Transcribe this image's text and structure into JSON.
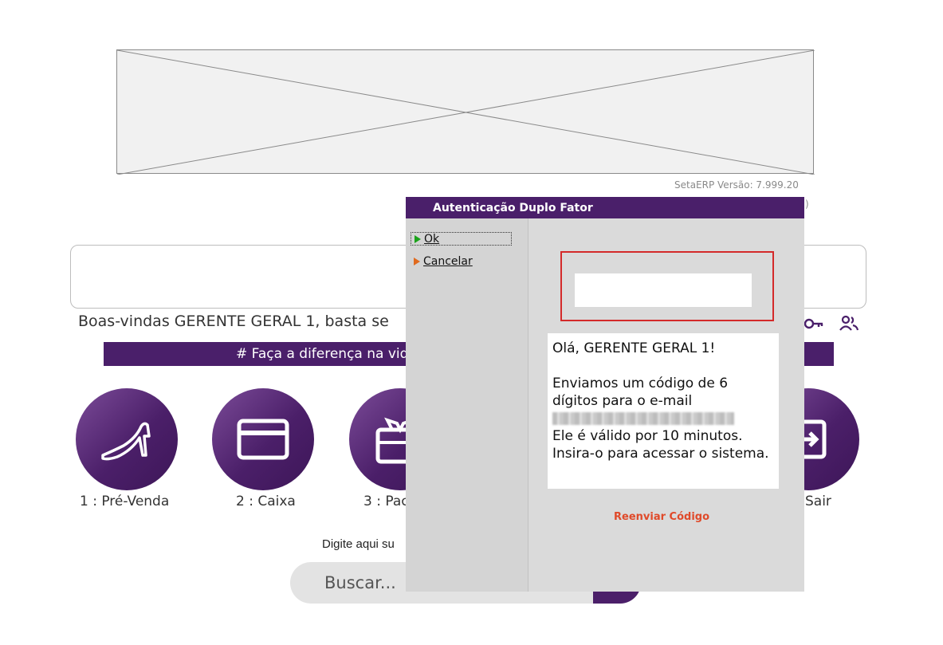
{
  "app": {
    "version_text": "SetaERP Versão: 7.999.20",
    "version_text_2": ")"
  },
  "welcome": {
    "text": "Boas-vindas GERENTE GERAL 1, basta se"
  },
  "banner": {
    "text": "# Faça a diferença na vid"
  },
  "menu": {
    "items": [
      {
        "label": "1 : Pré-Venda",
        "icon": "high-heel-shoe-icon"
      },
      {
        "label": "2 : Caixa",
        "icon": "card-icon"
      },
      {
        "label": "3 : Pac",
        "icon": "gift-box-icon"
      },
      {
        "label": "Sair",
        "icon": "exit-icon"
      }
    ]
  },
  "search": {
    "hint": "Digite aqui su",
    "placeholder": "Buscar..."
  },
  "modal": {
    "title": "Autenticação Duplo Fator",
    "ok_label": "Ok",
    "cancel_label": "Cancelar",
    "greeting": "Olá, GERENTE GERAL 1!",
    "line1": "Enviamos um código de 6",
    "line2": "dígitos para o e-mail",
    "line4": "Ele é válido por 10 minutos.",
    "line5": "Insira-o para acessar o sistema.",
    "resend_label": "Reenviar Código"
  },
  "colors": {
    "brand": "#4a1f6a",
    "ok_arrow": "#1aa21a",
    "cancel_arrow": "#e06a1e",
    "highlight": "#d42a2a",
    "resend": "#e04a2a"
  }
}
